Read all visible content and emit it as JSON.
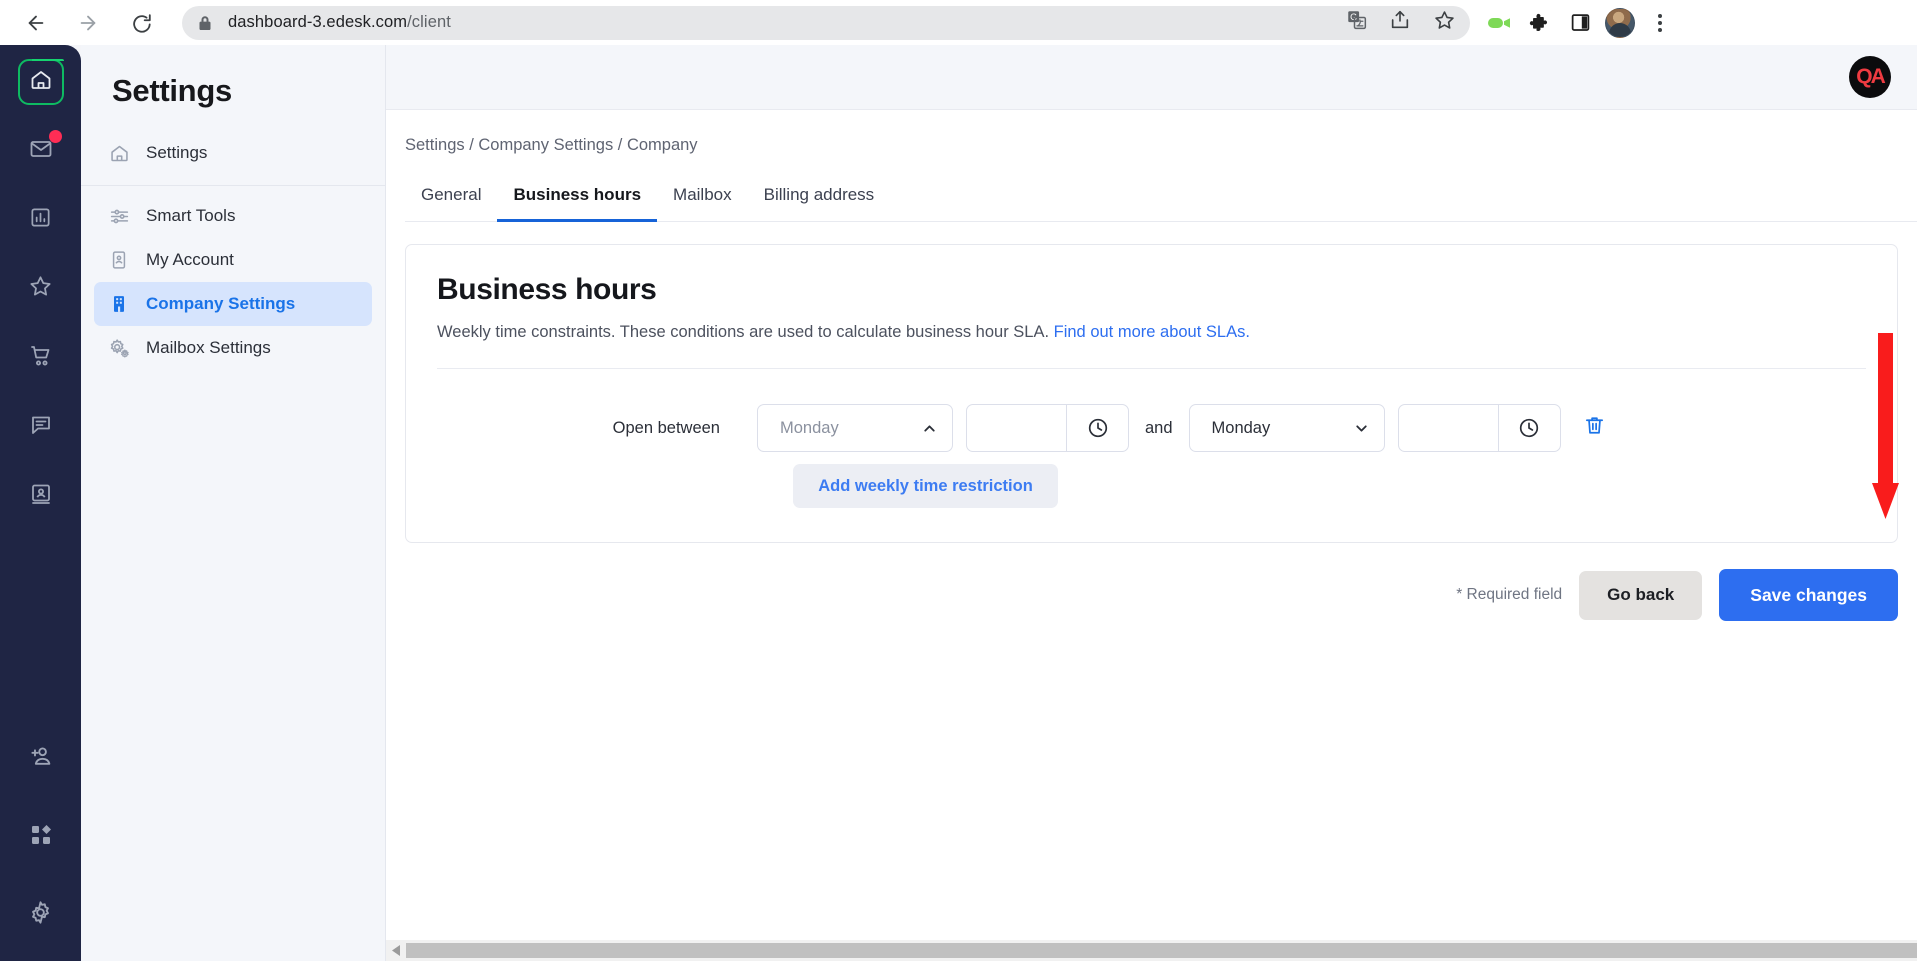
{
  "browser": {
    "url_host": "dashboard-3.edesk.com",
    "url_path": "/client",
    "back_icon": "arrow-left-icon",
    "forward_icon": "arrow-right-icon",
    "reload_icon": "reload-icon",
    "lock_icon": "lock-icon",
    "translate_icon": "translate-icon",
    "share_icon": "share-icon",
    "bookmark_icon": "star-icon",
    "camera_icon": "video-camera-icon",
    "extensions_icon": "puzzle-icon",
    "sidepanel_icon": "side-panel-icon",
    "profile_icon": "profile-avatar",
    "menu_icon": "three-dots-menu-icon"
  },
  "rail": {
    "items": [
      {
        "name": "home",
        "icon": "home-icon",
        "active": true
      },
      {
        "name": "inbox",
        "icon": "mail-icon",
        "badge": true
      },
      {
        "name": "reports",
        "icon": "bar-chart-icon"
      },
      {
        "name": "favourites",
        "icon": "star-icon"
      },
      {
        "name": "orders",
        "icon": "shopping-cart-icon"
      },
      {
        "name": "chat",
        "icon": "chat-icon"
      },
      {
        "name": "contacts",
        "icon": "contact-card-icon"
      }
    ],
    "bottom_items": [
      {
        "name": "invite-user",
        "icon": "add-user-icon"
      },
      {
        "name": "apps",
        "icon": "apps-grid-icon"
      },
      {
        "name": "settings",
        "icon": "gear-icon"
      }
    ]
  },
  "settings_nav": {
    "title": "Settings",
    "items": [
      {
        "label": "Settings",
        "icon": "home-icon",
        "active": false
      },
      {
        "label": "Smart Tools",
        "icon": "sliders-icon",
        "active": false
      },
      {
        "label": "My Account",
        "icon": "id-card-icon",
        "active": false
      },
      {
        "label": "Company Settings",
        "icon": "building-icon",
        "active": true
      },
      {
        "label": "Mailbox Settings",
        "icon": "gears-icon",
        "active": false
      }
    ]
  },
  "header": {
    "avatar_initials": "QA"
  },
  "breadcrumb": "Settings / Company Settings / Company",
  "tabs": [
    {
      "label": "General",
      "active": false
    },
    {
      "label": "Business hours",
      "active": true
    },
    {
      "label": "Mailbox",
      "active": false
    },
    {
      "label": "Billing address",
      "active": false
    }
  ],
  "card": {
    "title": "Business hours",
    "description": "Weekly time constraints. These conditions are used to calculate business hour SLA.",
    "link_text": "Find out more about SLAs.",
    "link_color": "#2d6ef0"
  },
  "form": {
    "row_label": "Open between",
    "day_from": {
      "value": "Monday",
      "placeholder": "Monday",
      "state": "open",
      "chevron": "chevron-up-icon"
    },
    "time_from": {
      "value": "",
      "placeholder": "",
      "icon": "clock-icon"
    },
    "conjunction": "and",
    "day_to": {
      "value": "Monday",
      "placeholder": "Monday",
      "state": "closed",
      "chevron": "chevron-down-icon"
    },
    "time_to": {
      "value": "",
      "placeholder": "",
      "icon": "clock-icon"
    },
    "delete_icon": "trash-icon",
    "delete_color": "#1a73e8",
    "add_button_label": "Add weekly time restriction"
  },
  "footer": {
    "required_note": "* Required field",
    "go_back_label": "Go back",
    "save_label": "Save changes",
    "save_color": "#2d6ef0"
  },
  "annotation": {
    "arrow_icon": "red-down-arrow",
    "arrow_color": "#f91c1c"
  },
  "scrollbar": {
    "left_arrow_icon": "triangle-left-icon"
  }
}
